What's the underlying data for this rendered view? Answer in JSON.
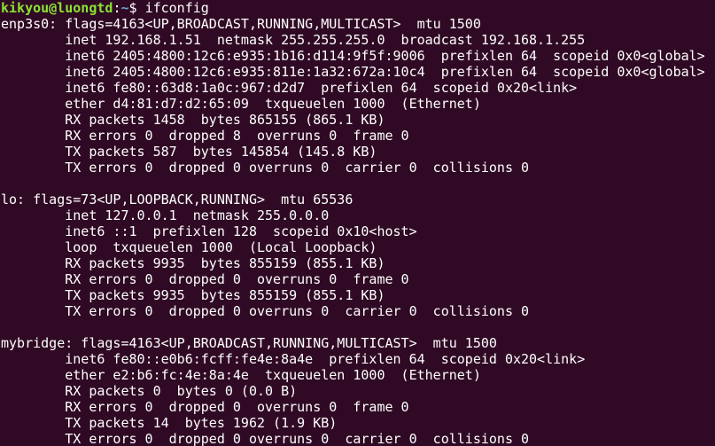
{
  "prompt": {
    "user_host": "kikyou@luongtd",
    "colon": ":",
    "path": "~",
    "symbol": "$ ",
    "command": "ifconfig"
  },
  "lines": [
    "enp3s0: flags=4163<UP,BROADCAST,RUNNING,MULTICAST>  mtu 1500",
    "        inet 192.168.1.51  netmask 255.255.255.0  broadcast 192.168.1.255",
    "        inet6 2405:4800:12c6:e935:1b16:d114:9f5f:9006  prefixlen 64  scopeid 0x0<global>",
    "        inet6 2405:4800:12c6:e935:811e:1a32:672a:10c4  prefixlen 64  scopeid 0x0<global>",
    "        inet6 fe80::63d8:1a0c:967:d2d7  prefixlen 64  scopeid 0x20<link>",
    "        ether d4:81:d7:d2:65:09  txqueuelen 1000  (Ethernet)",
    "        RX packets 1458  bytes 865155 (865.1 KB)",
    "        RX errors 0  dropped 8  overruns 0  frame 0",
    "        TX packets 587  bytes 145854 (145.8 KB)",
    "        TX errors 0  dropped 0 overruns 0  carrier 0  collisions 0",
    "",
    "lo: flags=73<UP,LOOPBACK,RUNNING>  mtu 65536",
    "        inet 127.0.0.1  netmask 255.0.0.0",
    "        inet6 ::1  prefixlen 128  scopeid 0x10<host>",
    "        loop  txqueuelen 1000  (Local Loopback)",
    "        RX packets 9935  bytes 855159 (855.1 KB)",
    "        RX errors 0  dropped 0  overruns 0  frame 0",
    "        TX packets 9935  bytes 855159 (855.1 KB)",
    "        TX errors 0  dropped 0 overruns 0  carrier 0  collisions 0",
    "",
    "mybridge: flags=4163<UP,BROADCAST,RUNNING,MULTICAST>  mtu 1500",
    "        inet6 fe80::e0b6:fcff:fe4e:8a4e  prefixlen 64  scopeid 0x20<link>",
    "        ether e2:b6:fc:4e:8a:4e  txqueuelen 1000  (Ethernet)",
    "        RX packets 0  bytes 0 (0.0 B)",
    "        RX errors 0  dropped 0  overruns 0  frame 0",
    "        TX packets 14  bytes 1962 (1.9 KB)",
    "        TX errors 0  dropped 0 overruns 0  carrier 0  collisions 0"
  ],
  "colors": {
    "background": "#300a24",
    "foreground": "#ffffff",
    "user_host": "#8ae234",
    "path": "#729fcf"
  }
}
